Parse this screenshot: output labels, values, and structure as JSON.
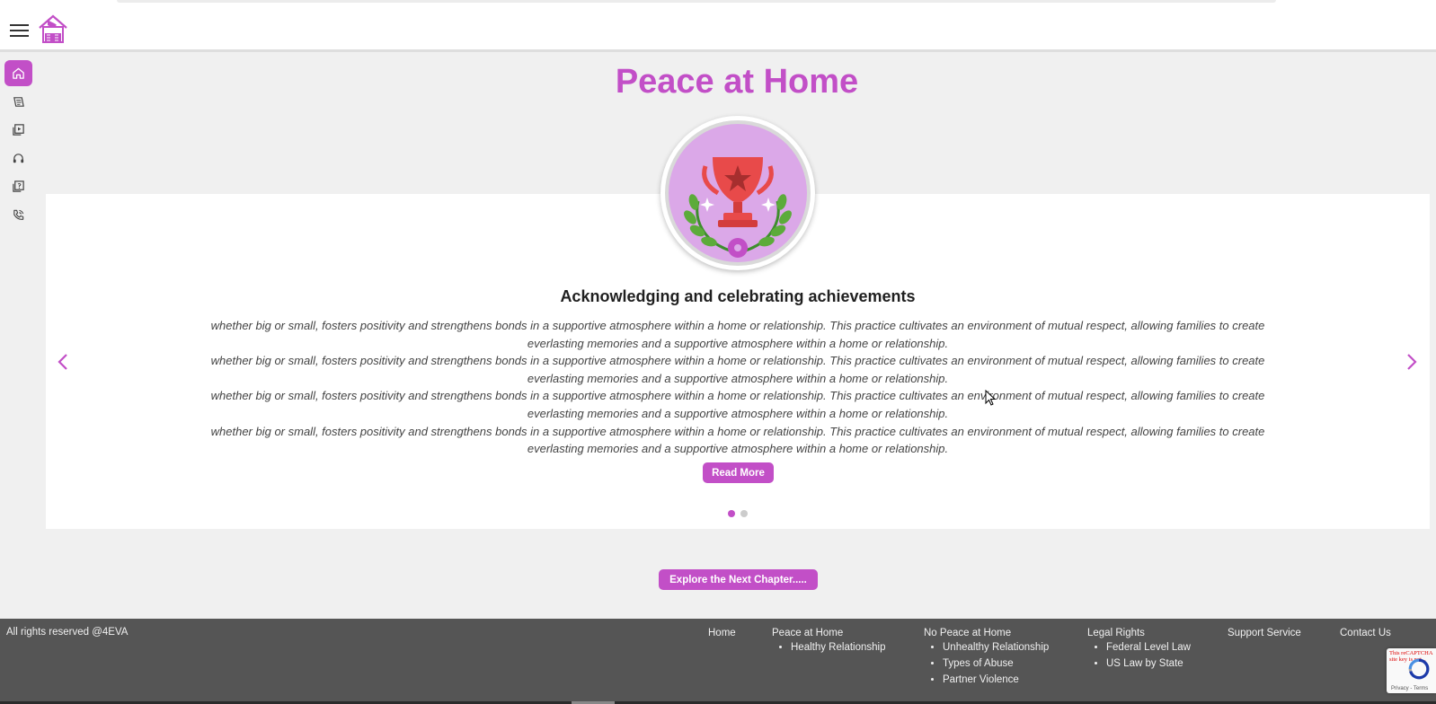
{
  "app": {
    "name": "Peace at Home"
  },
  "brand": {
    "accent": "#c24fc7",
    "footer_bg": "#555555"
  },
  "header": {
    "menu_icon": "hamburger-menu-icon",
    "logo_icon": "house-logo-icon"
  },
  "sidebar": {
    "items": [
      {
        "icon": "home-icon",
        "active": true
      },
      {
        "icon": "legal-scroll-icon",
        "active": false
      },
      {
        "icon": "video-library-icon",
        "active": false
      },
      {
        "icon": "support-headset-icon",
        "active": false
      },
      {
        "icon": "quiz-book-icon",
        "active": false
      },
      {
        "icon": "phone-call-icon",
        "active": false
      }
    ]
  },
  "page": {
    "title": "Peace at Home"
  },
  "carousel": {
    "heading": "Acknowledging and celebrating achievements",
    "paragraphs": [
      "whether big or small, fosters positivity and strengthens bonds in a supportive atmosphere within a home or relationship. This practice cultivates an environment of mutual respect, allowing families to create everlasting memories and a supportive atmosphere within a home or relationship.",
      "whether big or small, fosters positivity and strengthens bonds in a supportive atmosphere within a home or relationship. This practice cultivates an environment of mutual respect, allowing families to create everlasting memories and a supportive atmosphere within a home or relationship.",
      "whether big or small, fosters positivity and strengthens bonds in a supportive atmosphere within a home or relationship. This practice cultivates an environment of mutual respect, allowing families to create everlasting memories and a supportive atmosphere within a home or relationship.",
      "whether big or small, fosters positivity and strengthens bonds in a supportive atmosphere within a home or relationship. This practice cultivates an environment of mutual respect, allowing families to create everlasting memories and a supportive atmosphere within a home or relationship."
    ],
    "read_more_label": "Read More",
    "image_icon": "trophy-laurel-icon",
    "prev_icon": "chevron-left-icon",
    "next_icon": "chevron-right-icon",
    "slide_count": 2,
    "active_slide": 1
  },
  "explore_label": "Explore the Next Chapter.....",
  "footer": {
    "copyright": "All rights reserved @4EVA",
    "nav": [
      {
        "label": "Home",
        "children": []
      },
      {
        "label": "Peace at Home",
        "children": [
          "Healthy Relationship"
        ]
      },
      {
        "label": "No Peace at Home",
        "children": [
          "Unhealthy Relationship",
          "Types of Abuse",
          "Partner Violence"
        ]
      },
      {
        "label": "Legal Rights",
        "children": [
          "Federal Level Law",
          "US Law by State"
        ]
      },
      {
        "label": "Support Service",
        "children": []
      },
      {
        "label": "Contact Us",
        "children": []
      }
    ]
  },
  "recaptcha": {
    "error_text": "This reCAPTCHA site key is not...",
    "terms_text": "Privacy - Terms"
  }
}
